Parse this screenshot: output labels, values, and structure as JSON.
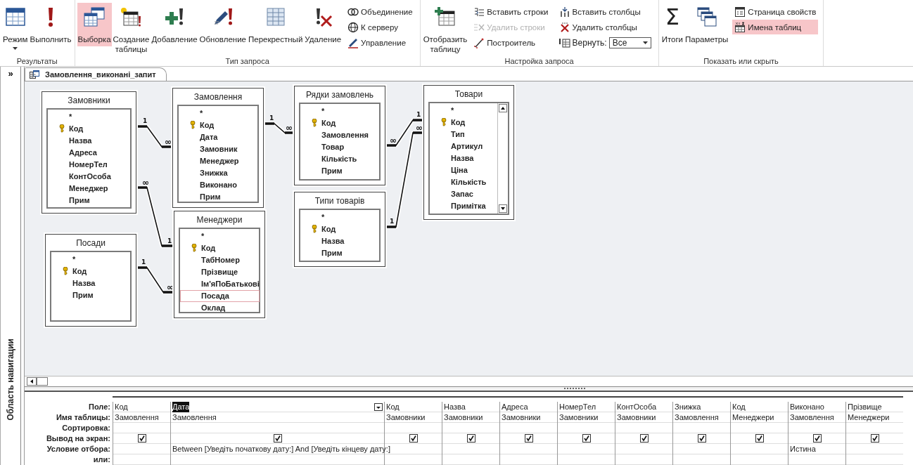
{
  "ribbon": {
    "groups": [
      {
        "label": "Результаты",
        "items": [
          {
            "kind": "split",
            "label": "Режим",
            "selected": false,
            "disabled": false
          },
          {
            "kind": "big",
            "label": "Выполнить",
            "selected": false,
            "disabled": false
          }
        ]
      },
      {
        "label": "Тип запроса",
        "items": [
          {
            "kind": "big",
            "label": "Выборка",
            "selected": true,
            "disabled": false
          },
          {
            "kind": "big",
            "label": "Создание таблицы",
            "selected": false,
            "disabled": false
          },
          {
            "kind": "big",
            "label": "Добавление",
            "selected": false,
            "disabled": false
          },
          {
            "kind": "big",
            "label": "Обновление",
            "selected": false,
            "disabled": false
          },
          {
            "kind": "big",
            "label": "Перекрестный",
            "selected": false,
            "disabled": false
          },
          {
            "kind": "big",
            "label": "Удаление",
            "selected": false,
            "disabled": false
          },
          {
            "kind": "small",
            "label": "Объединение",
            "selected": false,
            "disabled": false
          },
          {
            "kind": "small",
            "label": "К серверу",
            "selected": false,
            "disabled": false
          },
          {
            "kind": "small",
            "label": "Управление",
            "selected": false,
            "disabled": false
          }
        ]
      },
      {
        "label": "Настройка запроса",
        "items": [
          {
            "kind": "big",
            "label": "Отобразить таблицу",
            "selected": false,
            "disabled": false
          },
          {
            "kind": "small",
            "label": "Вставить строки",
            "selected": false,
            "disabled": false
          },
          {
            "kind": "small",
            "label": "Удалить строки",
            "selected": false,
            "disabled": true
          },
          {
            "kind": "small",
            "label": "Построитель",
            "selected": false,
            "disabled": false
          },
          {
            "kind": "small",
            "label": "Вставить столбцы",
            "selected": false,
            "disabled": false
          },
          {
            "kind": "small",
            "label": "Удалить столбцы",
            "selected": false,
            "disabled": false
          },
          {
            "kind": "combo",
            "label": "Вернуть:",
            "value": "Все",
            "selected": false,
            "disabled": false
          }
        ]
      },
      {
        "label": "Показать или скрыть",
        "items": [
          {
            "kind": "big",
            "label": "Итоги",
            "glyph": "Σ",
            "selected": false,
            "disabled": false
          },
          {
            "kind": "big",
            "label": "Параметры",
            "selected": false,
            "disabled": false
          },
          {
            "kind": "small",
            "label": "Страница свойств",
            "selected": false,
            "disabled": false
          },
          {
            "kind": "small",
            "label": "Имена таблиц",
            "selected": true,
            "disabled": false
          }
        ]
      }
    ]
  },
  "nav_pane": {
    "toggle": "»",
    "label": "Область навигации"
  },
  "document_tab": {
    "title": "Замовлення_виконані_запит",
    "selected": true
  },
  "tables": [
    {
      "title": "Замовники",
      "scrollbar": false,
      "fields": [
        {
          "name": "*",
          "key": false,
          "selected": false
        },
        {
          "name": "Код",
          "key": true,
          "selected": false
        },
        {
          "name": "Назва",
          "key": false,
          "selected": false
        },
        {
          "name": "Адреса",
          "key": false,
          "selected": false
        },
        {
          "name": "НомерТел",
          "key": false,
          "selected": false
        },
        {
          "name": "КонтОсоба",
          "key": false,
          "selected": false
        },
        {
          "name": "Менеджер",
          "key": false,
          "selected": false
        },
        {
          "name": "Прим",
          "key": false,
          "selected": false
        }
      ]
    },
    {
      "title": "Замовлення",
      "scrollbar": false,
      "fields": [
        {
          "name": "*",
          "key": false,
          "selected": false
        },
        {
          "name": "Код",
          "key": true,
          "selected": false
        },
        {
          "name": "Дата",
          "key": false,
          "selected": false
        },
        {
          "name": "Замовник",
          "key": false,
          "selected": false
        },
        {
          "name": "Менеджер",
          "key": false,
          "selected": false
        },
        {
          "name": "Знижка",
          "key": false,
          "selected": false
        },
        {
          "name": "Виконано",
          "key": false,
          "selected": false
        },
        {
          "name": "Прим",
          "key": false,
          "selected": false
        }
      ]
    },
    {
      "title": "Рядки замовлень",
      "scrollbar": false,
      "fields": [
        {
          "name": "*",
          "key": false,
          "selected": false
        },
        {
          "name": "Код",
          "key": true,
          "selected": false
        },
        {
          "name": "Замовлення",
          "key": false,
          "selected": false
        },
        {
          "name": "Товар",
          "key": false,
          "selected": false
        },
        {
          "name": "Кількість",
          "key": false,
          "selected": false
        },
        {
          "name": "Прим",
          "key": false,
          "selected": false
        }
      ]
    },
    {
      "title": "Товари",
      "scrollbar": true,
      "fields": [
        {
          "name": "*",
          "key": false,
          "selected": false
        },
        {
          "name": "Код",
          "key": true,
          "selected": false
        },
        {
          "name": "Тип",
          "key": false,
          "selected": false
        },
        {
          "name": "Артикул",
          "key": false,
          "selected": false
        },
        {
          "name": "Назва",
          "key": false,
          "selected": false
        },
        {
          "name": "Ціна",
          "key": false,
          "selected": false
        },
        {
          "name": "Кількість",
          "key": false,
          "selected": false
        },
        {
          "name": "Запас",
          "key": false,
          "selected": false
        },
        {
          "name": "Примітка",
          "key": false,
          "selected": false
        }
      ]
    },
    {
      "title": "Менеджери",
      "scrollbar": false,
      "fields": [
        {
          "name": "*",
          "key": false,
          "selected": false
        },
        {
          "name": "Код",
          "key": true,
          "selected": false
        },
        {
          "name": "ТабНомер",
          "key": false,
          "selected": false
        },
        {
          "name": "Прізвище",
          "key": false,
          "selected": false
        },
        {
          "name": "Ім'яПоБатькові",
          "key": false,
          "selected": false
        },
        {
          "name": "Посада",
          "key": false,
          "selected": true
        },
        {
          "name": "Оклад",
          "key": false,
          "selected": false
        }
      ]
    },
    {
      "title": "Типи товарів",
      "scrollbar": false,
      "fields": [
        {
          "name": "*",
          "key": false,
          "selected": false
        },
        {
          "name": "Код",
          "key": true,
          "selected": false
        },
        {
          "name": "Назва",
          "key": false,
          "selected": false
        },
        {
          "name": "Прим",
          "key": false,
          "selected": false
        }
      ]
    },
    {
      "title": "Посади",
      "scrollbar": false,
      "fields": [
        {
          "name": "*",
          "key": false,
          "selected": false
        },
        {
          "name": "Код",
          "key": true,
          "selected": false
        },
        {
          "name": "Назва",
          "key": false,
          "selected": false
        },
        {
          "name": "Прим",
          "key": false,
          "selected": false
        }
      ]
    }
  ],
  "relationships": [
    {
      "one": "1",
      "many": "∞"
    },
    {
      "one": "1",
      "many": "∞"
    },
    {
      "one": "1",
      "many": "∞"
    },
    {
      "one": "1",
      "many": "∞"
    },
    {
      "one": "1",
      "many": "∞"
    },
    {
      "one": "1",
      "many": "∞"
    }
  ],
  "design_grid": {
    "row_labels": [
      "Поле:",
      "Имя таблицы:",
      "Сортировка:",
      "Вывод на экран:",
      "Условие отбора:",
      "или:"
    ],
    "columns": [
      {
        "field": "Код",
        "table": "Замовлення",
        "show": true,
        "selected": false
      },
      {
        "field": "Дата",
        "table": "Замовлення",
        "show": true,
        "selected": true,
        "criteria": "Between [Уведіть початкову дату:] And [Уведіть кінцеву дату:]"
      },
      {
        "field": "Код",
        "table": "Замовники",
        "show": true,
        "selected": false
      },
      {
        "field": "Назва",
        "table": "Замовники",
        "show": true,
        "selected": false
      },
      {
        "field": "Адреса",
        "table": "Замовники",
        "show": true,
        "selected": false
      },
      {
        "field": "НомерТел",
        "table": "Замовники",
        "show": true,
        "selected": false
      },
      {
        "field": "КонтОсоба",
        "table": "Замовники",
        "show": true,
        "selected": false
      },
      {
        "field": "Знижка",
        "table": "Замовлення",
        "show": true,
        "selected": false
      },
      {
        "field": "Код",
        "table": "Менеджери",
        "show": true,
        "selected": false
      },
      {
        "field": "Виконано",
        "table": "Замовлення",
        "show": true,
        "selected": false,
        "criteria": "Истина"
      },
      {
        "field": "Прізвище",
        "table": "Менеджери",
        "show": true,
        "selected": false
      }
    ]
  }
}
